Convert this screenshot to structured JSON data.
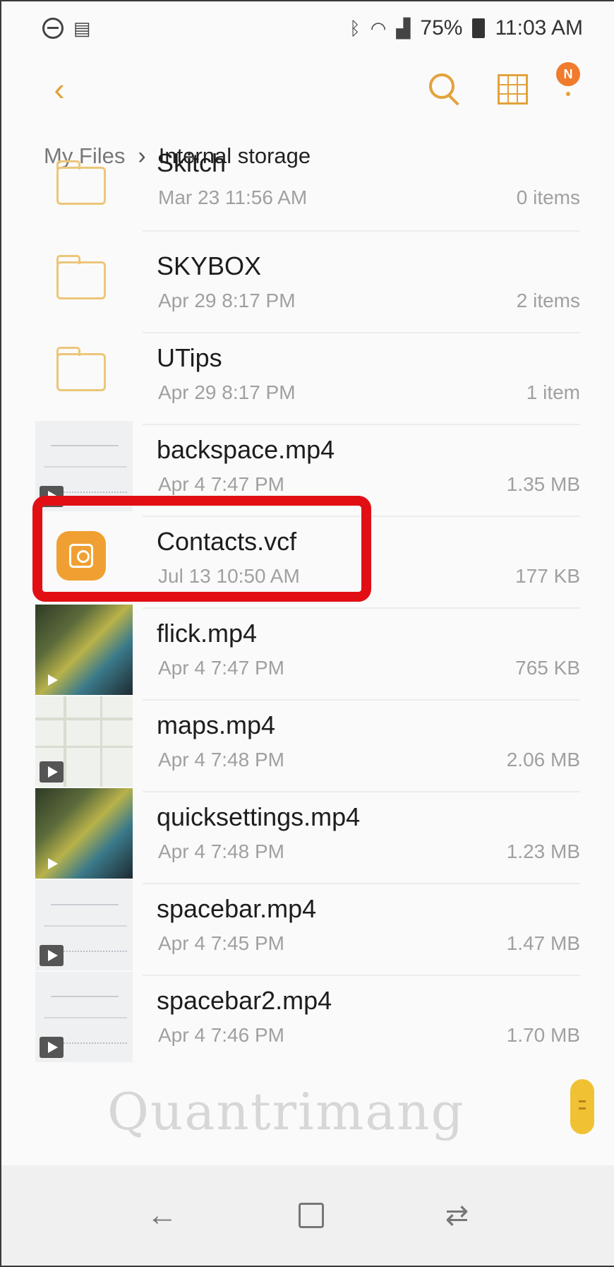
{
  "status": {
    "time": "11:03 AM",
    "battery": "75%"
  },
  "toolbar": {
    "notification_badge": "N"
  },
  "breadcrumb": {
    "root": "My Files",
    "separator": "›",
    "current": "Internal storage"
  },
  "files": [
    {
      "name": "Skitch",
      "date": "Mar 23 11:56 AM",
      "meta": "0 items",
      "kind": "folder"
    },
    {
      "name": "SKYBOX",
      "date": "Apr 29 8:17 PM",
      "meta": "2 items",
      "kind": "folder"
    },
    {
      "name": "UTips",
      "date": "Apr 29 8:17 PM",
      "meta": "1 item",
      "kind": "folder"
    },
    {
      "name": "backspace.mp4",
      "date": "Apr 4 7:47 PM",
      "meta": "1.35 MB",
      "kind": "video"
    },
    {
      "name": "Contacts.vcf",
      "date": "Jul 13 10:50 AM",
      "meta": "177 KB",
      "kind": "contact"
    },
    {
      "name": "flick.mp4",
      "date": "Apr 4 7:47 PM",
      "meta": "765 KB",
      "kind": "video"
    },
    {
      "name": "maps.mp4",
      "date": "Apr 4 7:48 PM",
      "meta": "2.06 MB",
      "kind": "video"
    },
    {
      "name": "quicksettings.mp4",
      "date": "Apr 4 7:48 PM",
      "meta": "1.23 MB",
      "kind": "video"
    },
    {
      "name": "spacebar.mp4",
      "date": "Apr 4 7:45 PM",
      "meta": "1.47 MB",
      "kind": "video"
    },
    {
      "name": "spacebar2.mp4",
      "date": "Apr 4 7:46 PM",
      "meta": "1.70 MB",
      "kind": "video"
    }
  ],
  "watermark": "Quantrimang",
  "colors": {
    "accent": "#e3a23c",
    "highlight": "#e10f14",
    "contact_icon": "#f0a032"
  }
}
